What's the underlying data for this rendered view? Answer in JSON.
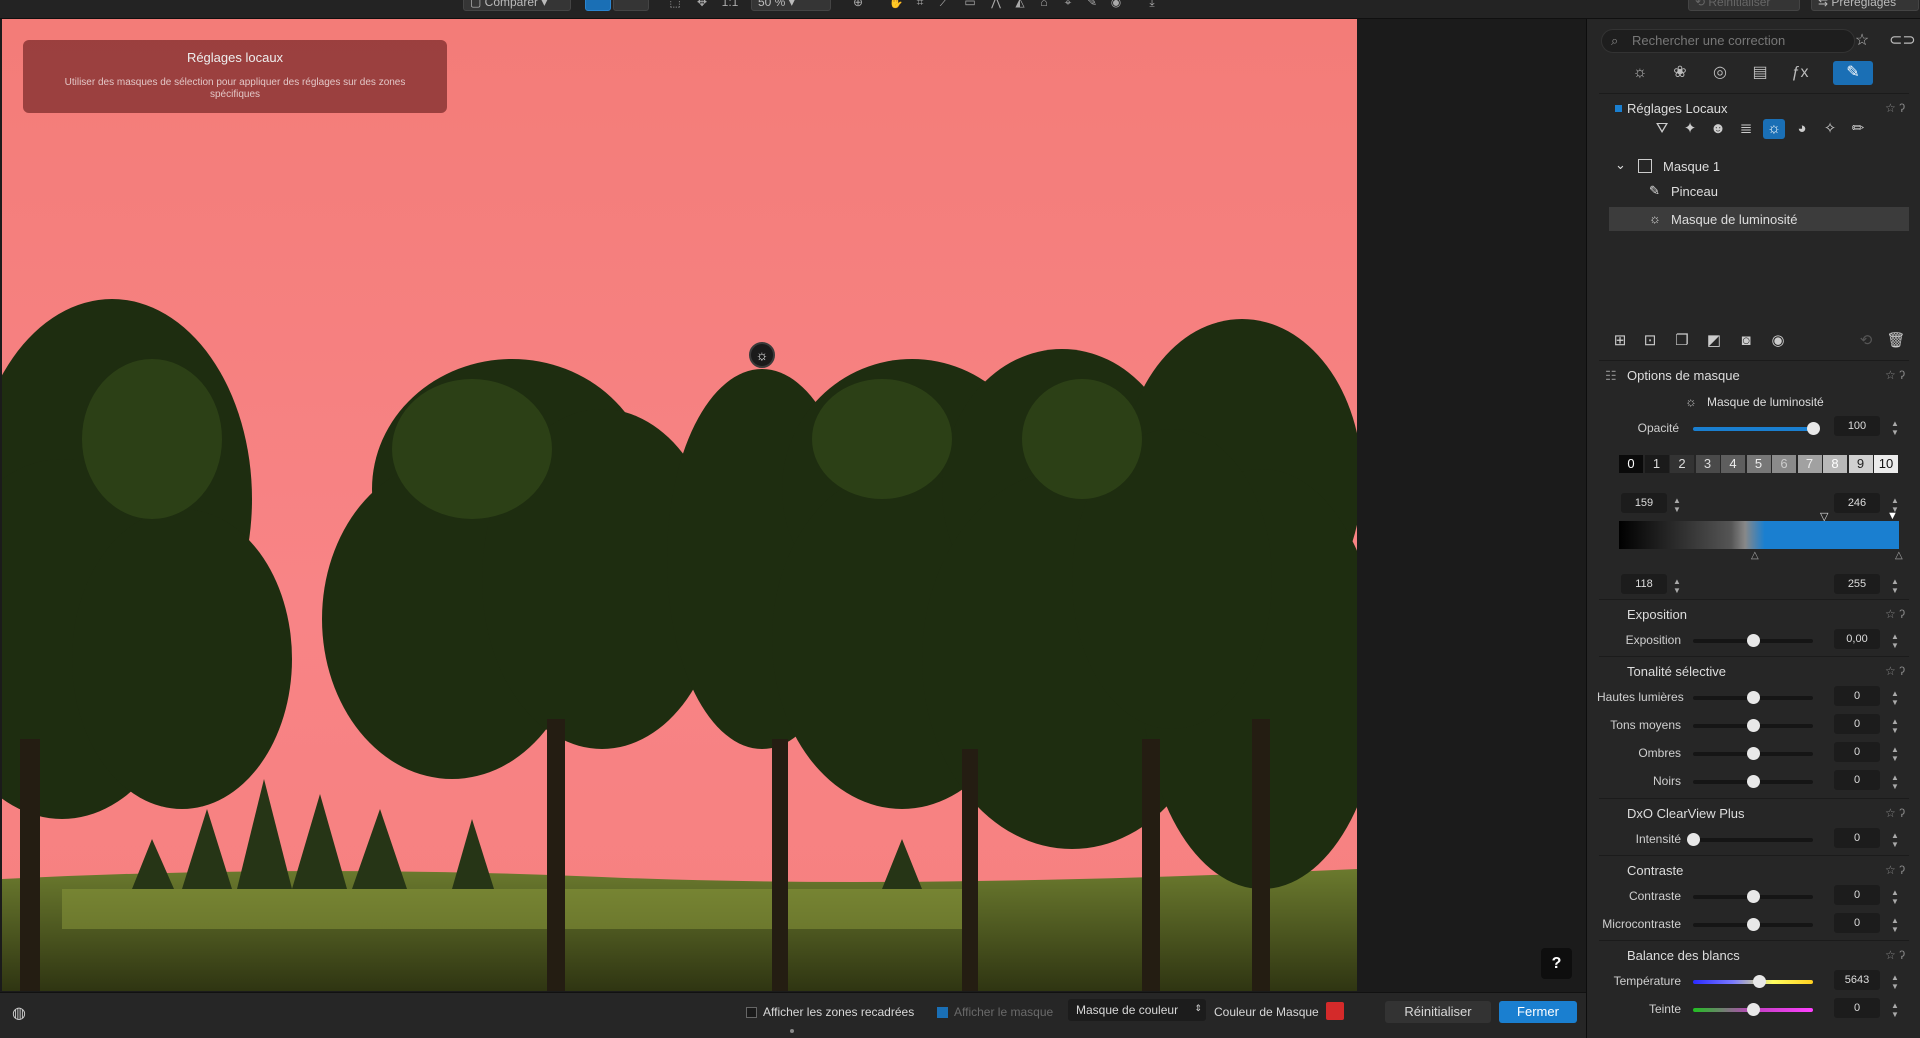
{
  "toolbar": {
    "compare_label": "Comparer",
    "ratio_label": "1:1",
    "zoom_label": "50 %",
    "reset_label": "Réinitialiser",
    "presets_label": "Préréglages"
  },
  "viewer": {
    "hint_title": "Réglages locaux",
    "hint_desc": "Utiliser des masques de sélection pour appliquer des réglages sur des zones spécifiques",
    "help_label": "?"
  },
  "bottom": {
    "show_crop_label": "Afficher les zones recadrées",
    "show_mask_label": "Afficher le masque",
    "mask_mode_value": "Masque de couleur",
    "mask_color_label": "Couleur de Masque",
    "mask_color": "#d42a2a",
    "reset_label": "Réinitialiser",
    "close_label": "Fermer"
  },
  "panel": {
    "search_placeholder": "Rechercher une correction",
    "local_title": "Réglages Locaux",
    "mask_name": "Masque 1",
    "mask_items": [
      "Pinceau",
      "Masque de luminosité"
    ],
    "mask_options_title": "Options de masque",
    "mask_type_label": "Masque de luminosité",
    "opacity_label": "Opacité",
    "opacity_value": "100",
    "opacity_pct": 1.0,
    "zones": [
      "0",
      "1",
      "2",
      "3",
      "4",
      "5",
      "6",
      "7",
      "8",
      "9",
      "10"
    ],
    "range_top_left": "159",
    "range_top_right": "246",
    "range_bottom_left": "118",
    "range_bottom_right": "255",
    "sections": {
      "exposure": {
        "title": "Exposition",
        "rows": [
          {
            "label": "Exposition",
            "value": "0,00",
            "pos": 0.5
          }
        ]
      },
      "selective": {
        "title": "Tonalité sélective",
        "rows": [
          {
            "label": "Hautes lumières",
            "value": "0",
            "pos": 0.5
          },
          {
            "label": "Tons moyens",
            "value": "0",
            "pos": 0.5
          },
          {
            "label": "Ombres",
            "value": "0",
            "pos": 0.5
          },
          {
            "label": "Noirs",
            "value": "0",
            "pos": 0.5
          }
        ]
      },
      "clearview": {
        "title": "DxO ClearView Plus",
        "rows": [
          {
            "label": "Intensité",
            "value": "0",
            "pos": 0.0
          }
        ]
      },
      "contrast": {
        "title": "Contraste",
        "rows": [
          {
            "label": "Contraste",
            "value": "0",
            "pos": 0.5
          },
          {
            "label": "Microcontraste",
            "value": "0",
            "pos": 0.5
          }
        ]
      },
      "wb": {
        "title": "Balance des blancs",
        "rows": [
          {
            "label": "Température",
            "value": "5643",
            "pos": 0.55
          },
          {
            "label": "Teinte",
            "value": "0",
            "pos": 0.5
          }
        ]
      }
    }
  },
  "colors": {
    "accent": "#1a7fd0",
    "mask_overlay": "#f37c78",
    "panel": "#262626"
  }
}
